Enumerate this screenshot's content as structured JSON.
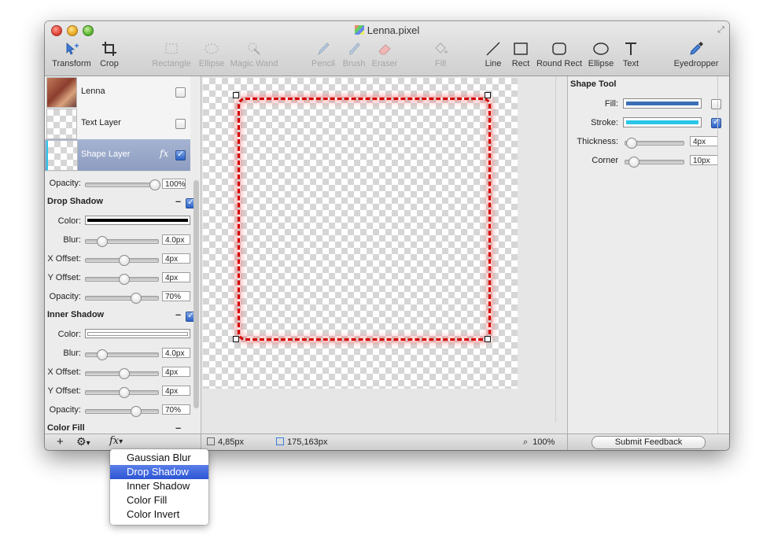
{
  "window": {
    "title": "Lenna.pixel"
  },
  "toolbar": {
    "tools": [
      {
        "label": "Transform",
        "icon": "move-arrows-icon",
        "enabled": true
      },
      {
        "label": "Crop",
        "icon": "crop-icon",
        "enabled": true
      },
      {
        "label": "Rectangle",
        "icon": "rectangle-select-icon",
        "enabled": false
      },
      {
        "label": "Ellipse",
        "icon": "ellipse-select-icon",
        "enabled": false
      },
      {
        "label": "Magic Wand",
        "icon": "magic-wand-icon",
        "enabled": false
      },
      {
        "label": "Pencil",
        "icon": "pencil-icon",
        "enabled": false
      },
      {
        "label": "Brush",
        "icon": "brush-icon",
        "enabled": false
      },
      {
        "label": "Eraser",
        "icon": "eraser-icon",
        "enabled": false
      },
      {
        "label": "Fill",
        "icon": "paint-bucket-icon",
        "enabled": false
      },
      {
        "label": "Line",
        "icon": "line-icon",
        "enabled": true
      },
      {
        "label": "Rect",
        "icon": "rect-shape-icon",
        "enabled": true
      },
      {
        "label": "Round Rect",
        "icon": "round-rect-icon",
        "enabled": true
      },
      {
        "label": "Ellipse",
        "icon": "ellipse-shape-icon",
        "enabled": true
      },
      {
        "label": "Text",
        "icon": "text-tool-icon",
        "enabled": true
      },
      {
        "label": "Eyedropper",
        "icon": "eyedropper-icon",
        "enabled": true
      }
    ]
  },
  "layers": [
    {
      "name": "Lenna",
      "checked": false,
      "selected": false
    },
    {
      "name": "Text Layer",
      "checked": false,
      "selected": false
    },
    {
      "name": "Shape Layer",
      "checked": true,
      "selected": true,
      "fx": "fx"
    }
  ],
  "effects": {
    "opacity_label": "Opacity:",
    "opacity_value": "100%",
    "opacity_level": 0.95,
    "drop_shadow": {
      "title": "Drop Shadow",
      "color_label": "Color:",
      "blur_label": "Blur:",
      "blur_value": "4.0px",
      "blur_level": 0.22,
      "xoffset_label": "X Offset:",
      "xoffset_value": "4px",
      "xoffset_level": 0.52,
      "yoffset_label": "Y Offset:",
      "yoffset_value": "4px",
      "yoffset_level": 0.52,
      "opacity_label": "Opacity:",
      "opacity_value": "70%",
      "opacity_level": 0.68
    },
    "inner_shadow": {
      "title": "Inner Shadow",
      "color_label": "Color:",
      "blur_label": "Blur:",
      "blur_value": "4.0px",
      "blur_level": 0.22,
      "xoffset_label": "X Offset:",
      "xoffset_value": "4px",
      "xoffset_level": 0.52,
      "yoffset_label": "Y Offset:",
      "yoffset_value": "4px",
      "yoffset_level": 0.52,
      "opacity_label": "Opacity:",
      "opacity_value": "70%",
      "opacity_level": 0.68
    },
    "color_fill": {
      "title": "Color Fill"
    }
  },
  "shape_tool": {
    "title": "Shape Tool",
    "fill_label": "Fill:",
    "fill_color": "#3a6fb5",
    "stroke_label": "Stroke:",
    "stroke_color": "#29c6e8",
    "thickness_label": "Thickness:",
    "thickness_value": "4px",
    "thickness_level": 0.1,
    "corner_label": "Corner",
    "corner_value": "10px",
    "corner_level": 0.14
  },
  "statusbar": {
    "position": "4,85px",
    "size": "175,163px",
    "zoom": "100%",
    "feedback_button": "Submit Feedback"
  },
  "bottom_buttons": {
    "add": "+",
    "gear_arrow": "▾",
    "fx": "fx",
    "fx_arrow": "▾"
  },
  "effects_menu": {
    "items": [
      "Gaussian Blur",
      "Drop Shadow",
      "Inner Shadow",
      "Color Fill",
      "Color Invert"
    ],
    "highlighted": 1
  },
  "colors": {
    "shape_stroke": "#d40000",
    "shape_glow": "#ff6a6a",
    "selection_blue": "#2d55d4"
  }
}
